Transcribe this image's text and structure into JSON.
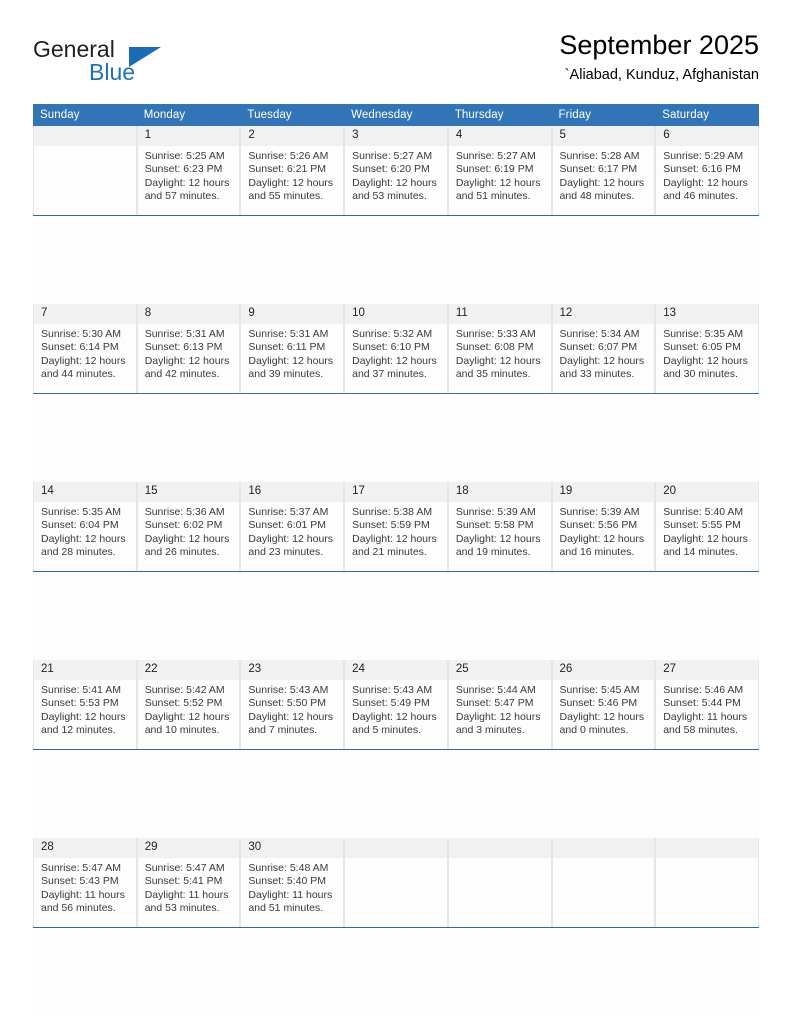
{
  "branding": {
    "logo_text_top": "General",
    "logo_text_bottom": "Blue",
    "accent_color": "#1a6cb5"
  },
  "header": {
    "title": "September 2025",
    "subtitle": "`Aliabad, Kunduz, Afghanistan"
  },
  "calendar": {
    "header_bg": "#3275b7",
    "daynum_bg": "#f1f1f1",
    "weekdays": [
      "Sunday",
      "Monday",
      "Tuesday",
      "Wednesday",
      "Thursday",
      "Friday",
      "Saturday"
    ],
    "weeks": [
      [
        {
          "day": "",
          "sunrise": "",
          "sunset": "",
          "daylight": ""
        },
        {
          "day": "1",
          "sunrise": "Sunrise: 5:25 AM",
          "sunset": "Sunset: 6:23 PM",
          "daylight": "Daylight: 12 hours and 57 minutes."
        },
        {
          "day": "2",
          "sunrise": "Sunrise: 5:26 AM",
          "sunset": "Sunset: 6:21 PM",
          "daylight": "Daylight: 12 hours and 55 minutes."
        },
        {
          "day": "3",
          "sunrise": "Sunrise: 5:27 AM",
          "sunset": "Sunset: 6:20 PM",
          "daylight": "Daylight: 12 hours and 53 minutes."
        },
        {
          "day": "4",
          "sunrise": "Sunrise: 5:27 AM",
          "sunset": "Sunset: 6:19 PM",
          "daylight": "Daylight: 12 hours and 51 minutes."
        },
        {
          "day": "5",
          "sunrise": "Sunrise: 5:28 AM",
          "sunset": "Sunset: 6:17 PM",
          "daylight": "Daylight: 12 hours and 48 minutes."
        },
        {
          "day": "6",
          "sunrise": "Sunrise: 5:29 AM",
          "sunset": "Sunset: 6:16 PM",
          "daylight": "Daylight: 12 hours and 46 minutes."
        }
      ],
      [
        {
          "day": "7",
          "sunrise": "Sunrise: 5:30 AM",
          "sunset": "Sunset: 6:14 PM",
          "daylight": "Daylight: 12 hours and 44 minutes."
        },
        {
          "day": "8",
          "sunrise": "Sunrise: 5:31 AM",
          "sunset": "Sunset: 6:13 PM",
          "daylight": "Daylight: 12 hours and 42 minutes."
        },
        {
          "day": "9",
          "sunrise": "Sunrise: 5:31 AM",
          "sunset": "Sunset: 6:11 PM",
          "daylight": "Daylight: 12 hours and 39 minutes."
        },
        {
          "day": "10",
          "sunrise": "Sunrise: 5:32 AM",
          "sunset": "Sunset: 6:10 PM",
          "daylight": "Daylight: 12 hours and 37 minutes."
        },
        {
          "day": "11",
          "sunrise": "Sunrise: 5:33 AM",
          "sunset": "Sunset: 6:08 PM",
          "daylight": "Daylight: 12 hours and 35 minutes."
        },
        {
          "day": "12",
          "sunrise": "Sunrise: 5:34 AM",
          "sunset": "Sunset: 6:07 PM",
          "daylight": "Daylight: 12 hours and 33 minutes."
        },
        {
          "day": "13",
          "sunrise": "Sunrise: 5:35 AM",
          "sunset": "Sunset: 6:05 PM",
          "daylight": "Daylight: 12 hours and 30 minutes."
        }
      ],
      [
        {
          "day": "14",
          "sunrise": "Sunrise: 5:35 AM",
          "sunset": "Sunset: 6:04 PM",
          "daylight": "Daylight: 12 hours and 28 minutes."
        },
        {
          "day": "15",
          "sunrise": "Sunrise: 5:36 AM",
          "sunset": "Sunset: 6:02 PM",
          "daylight": "Daylight: 12 hours and 26 minutes."
        },
        {
          "day": "16",
          "sunrise": "Sunrise: 5:37 AM",
          "sunset": "Sunset: 6:01 PM",
          "daylight": "Daylight: 12 hours and 23 minutes."
        },
        {
          "day": "17",
          "sunrise": "Sunrise: 5:38 AM",
          "sunset": "Sunset: 5:59 PM",
          "daylight": "Daylight: 12 hours and 21 minutes."
        },
        {
          "day": "18",
          "sunrise": "Sunrise: 5:39 AM",
          "sunset": "Sunset: 5:58 PM",
          "daylight": "Daylight: 12 hours and 19 minutes."
        },
        {
          "day": "19",
          "sunrise": "Sunrise: 5:39 AM",
          "sunset": "Sunset: 5:56 PM",
          "daylight": "Daylight: 12 hours and 16 minutes."
        },
        {
          "day": "20",
          "sunrise": "Sunrise: 5:40 AM",
          "sunset": "Sunset: 5:55 PM",
          "daylight": "Daylight: 12 hours and 14 minutes."
        }
      ],
      [
        {
          "day": "21",
          "sunrise": "Sunrise: 5:41 AM",
          "sunset": "Sunset: 5:53 PM",
          "daylight": "Daylight: 12 hours and 12 minutes."
        },
        {
          "day": "22",
          "sunrise": "Sunrise: 5:42 AM",
          "sunset": "Sunset: 5:52 PM",
          "daylight": "Daylight: 12 hours and 10 minutes."
        },
        {
          "day": "23",
          "sunrise": "Sunrise: 5:43 AM",
          "sunset": "Sunset: 5:50 PM",
          "daylight": "Daylight: 12 hours and 7 minutes."
        },
        {
          "day": "24",
          "sunrise": "Sunrise: 5:43 AM",
          "sunset": "Sunset: 5:49 PM",
          "daylight": "Daylight: 12 hours and 5 minutes."
        },
        {
          "day": "25",
          "sunrise": "Sunrise: 5:44 AM",
          "sunset": "Sunset: 5:47 PM",
          "daylight": "Daylight: 12 hours and 3 minutes."
        },
        {
          "day": "26",
          "sunrise": "Sunrise: 5:45 AM",
          "sunset": "Sunset: 5:46 PM",
          "daylight": "Daylight: 12 hours and 0 minutes."
        },
        {
          "day": "27",
          "sunrise": "Sunrise: 5:46 AM",
          "sunset": "Sunset: 5:44 PM",
          "daylight": "Daylight: 11 hours and 58 minutes."
        }
      ],
      [
        {
          "day": "28",
          "sunrise": "Sunrise: 5:47 AM",
          "sunset": "Sunset: 5:43 PM",
          "daylight": "Daylight: 11 hours and 56 minutes."
        },
        {
          "day": "29",
          "sunrise": "Sunrise: 5:47 AM",
          "sunset": "Sunset: 5:41 PM",
          "daylight": "Daylight: 11 hours and 53 minutes."
        },
        {
          "day": "30",
          "sunrise": "Sunrise: 5:48 AM",
          "sunset": "Sunset: 5:40 PM",
          "daylight": "Daylight: 11 hours and 51 minutes."
        },
        {
          "day": "",
          "sunrise": "",
          "sunset": "",
          "daylight": ""
        },
        {
          "day": "",
          "sunrise": "",
          "sunset": "",
          "daylight": ""
        },
        {
          "day": "",
          "sunrise": "",
          "sunset": "",
          "daylight": ""
        },
        {
          "day": "",
          "sunrise": "",
          "sunset": "",
          "daylight": ""
        }
      ]
    ]
  }
}
